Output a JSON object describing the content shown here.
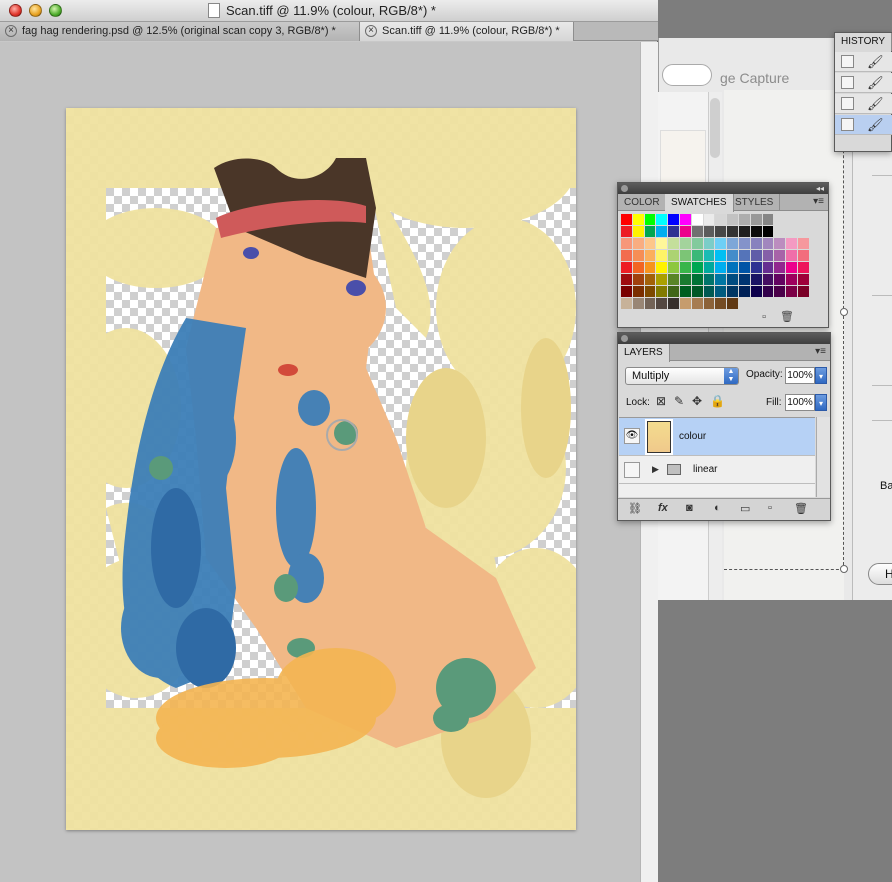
{
  "window": {
    "title": "Scan.tiff @ 11.9% (colour, RGB/8*) *",
    "tabs": [
      {
        "label": "fag hag rendering.psd @ 12.5% (original scan  copy 3, RGB/8*) *",
        "active": false
      },
      {
        "label": "Scan.tiff @ 11.9% (colour, RGB/8*) *",
        "active": true
      }
    ]
  },
  "background_app": {
    "title_fragment": "ge Capture",
    "side_label": "Ba",
    "button_label": "H"
  },
  "history_panel": {
    "tab": "HISTORY",
    "rows": 4,
    "selected_row": 4
  },
  "swatches_panel": {
    "tabs": [
      "COLOR",
      "SWATCHES",
      "STYLES"
    ],
    "active_tab": "SWATCHES",
    "rows": [
      [
        "#ff0000",
        "#ffff00",
        "#00ff00",
        "#00ffff",
        "#0000ff",
        "#ff00ff",
        "#ffffff",
        "#ebebeb",
        "#d6d6d6",
        "#c2c2c2",
        "#adadad",
        "#999999",
        "#858585"
      ],
      [
        "#ed1c24",
        "#fff200",
        "#00a651",
        "#00aeef",
        "#2e3192",
        "#ec008c",
        "#707070",
        "#5c5c5c",
        "#474747",
        "#333333",
        "#1f1f1f",
        "#0a0a0a",
        "#000000"
      ],
      [
        "#f7977a",
        "#f9ad81",
        "#fdc68a",
        "#fff79a",
        "#c4df9b",
        "#a3d39c",
        "#82ca9d",
        "#7bcdc8",
        "#6ecff6",
        "#7ea7d8",
        "#8493ca",
        "#8882be",
        "#a186be",
        "#bc8dbf",
        "#f49ac2",
        "#f6989d"
      ],
      [
        "#f26c4f",
        "#f68e55",
        "#fbaf5c",
        "#fff467",
        "#acd372",
        "#7cc576",
        "#3bb878",
        "#1abbb4",
        "#00bff3",
        "#438cca",
        "#5574b9",
        "#605ca8",
        "#855fa8",
        "#a763a8",
        "#f06ea9",
        "#f26d7d"
      ],
      [
        "#ed1c24",
        "#f26522",
        "#f7941d",
        "#fff200",
        "#8dc73f",
        "#39b54a",
        "#00a651",
        "#00a99d",
        "#00aeef",
        "#0072bc",
        "#0054a6",
        "#2e3192",
        "#662d91",
        "#92278f",
        "#ec008c",
        "#ed145b"
      ],
      [
        "#9e0b0f",
        "#a0410d",
        "#a36209",
        "#aba000",
        "#598527",
        "#1a7b30",
        "#007236",
        "#00746b",
        "#0076a3",
        "#004b80",
        "#003471",
        "#1b1464",
        "#440e62",
        "#630460",
        "#9e005d",
        "#9e0039"
      ],
      [
        "#790000",
        "#7b2e00",
        "#7d4900",
        "#827b00",
        "#406618",
        "#005e20",
        "#005826",
        "#005952",
        "#005b7f",
        "#003663",
        "#002157",
        "#0d004c",
        "#32004b",
        "#4b0049",
        "#7b0046",
        "#7a0026"
      ],
      [
        "#c7b299",
        "#998675",
        "#736357",
        "#534741",
        "#37302d",
        "#c69c6d",
        "#a67c52",
        "#8c6239",
        "#754c24",
        "#603913"
      ]
    ]
  },
  "layers_panel": {
    "tab": "LAYERS",
    "blend_mode": "Multiply",
    "opacity_label": "Opacity:",
    "opacity_value": "100%",
    "lock_label": "Lock:",
    "fill_label": "Fill:",
    "fill_value": "100%",
    "layers": [
      {
        "name": "colour",
        "visible": true,
        "selected": true,
        "type": "layer"
      },
      {
        "name": "linear",
        "visible": false,
        "selected": false,
        "type": "group"
      }
    ]
  },
  "icons": {
    "eye": "eye-icon",
    "folder": "folder-icon",
    "brush": "brush-icon",
    "link": "link-icon",
    "fx": "fx-icon",
    "mask": "mask-icon",
    "adjustment": "adjustment-icon",
    "new_group": "new-group-icon",
    "new_layer": "new-layer-icon",
    "trash": "trash-icon"
  }
}
